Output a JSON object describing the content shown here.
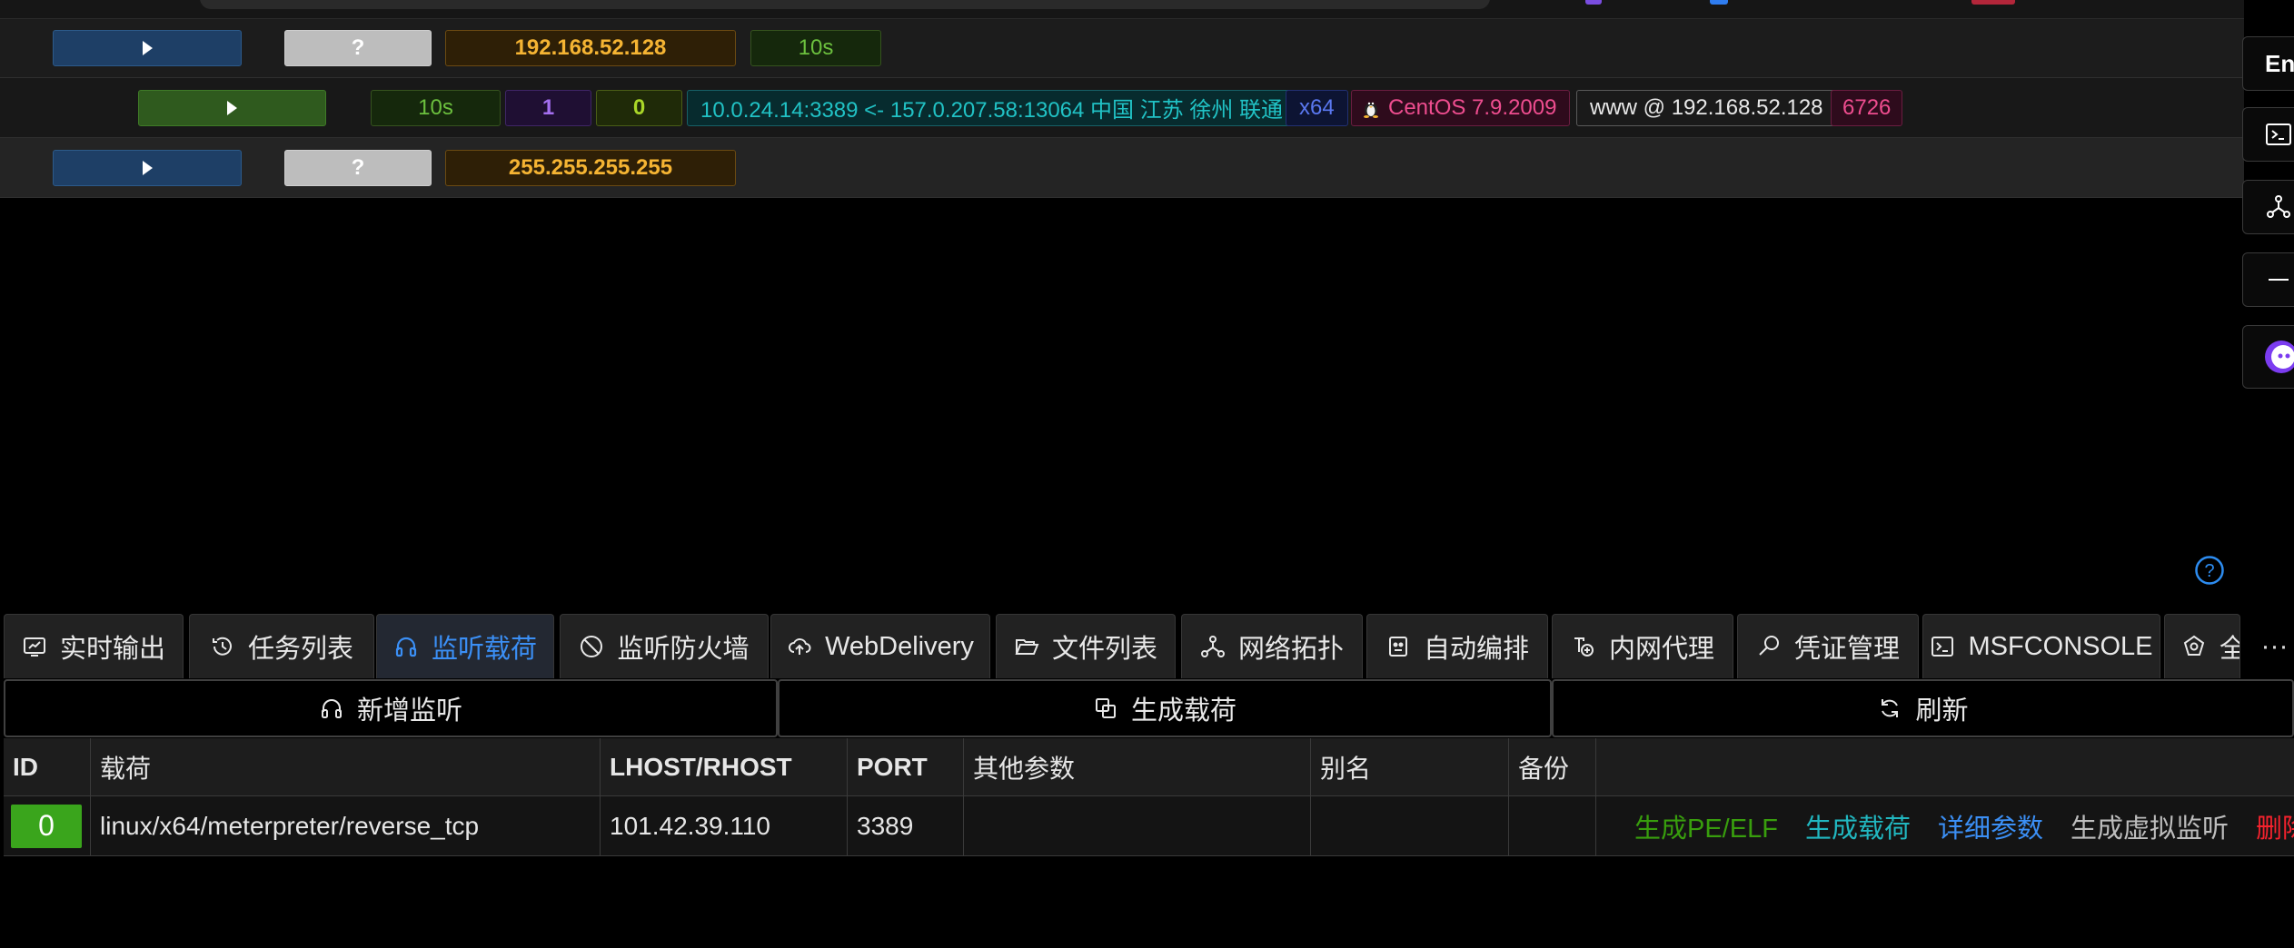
{
  "sessions": {
    "row1": {
      "status": "?",
      "ip": "192.168.52.128",
      "interval": "10s"
    },
    "row2": {
      "interval": "10s",
      "count_a": "1",
      "count_b": "0",
      "connection": "10.0.24.14:3389 <- 157.0.207.58:13064 中国 江苏 徐州 联通",
      "arch": "x64",
      "os": "CentOS 7.9.2009",
      "user_host": "www @ 192.168.52.128",
      "pid": "6726"
    },
    "row3": {
      "status": "?",
      "ip": "255.255.255.255"
    }
  },
  "side_buttons": {
    "lang_label": "En"
  },
  "tabs": [
    {
      "label": "实时输出",
      "icon": "monitor-icon"
    },
    {
      "label": "任务列表",
      "icon": "history-icon"
    },
    {
      "label": "监听载荷",
      "icon": "headphones-icon",
      "active": true
    },
    {
      "label": "监听防火墙",
      "icon": "stop-icon"
    },
    {
      "label": "WebDelivery",
      "icon": "cloud-upload-icon"
    },
    {
      "label": "文件列表",
      "icon": "folder-open-icon"
    },
    {
      "label": "网络拓扑",
      "icon": "topology-icon"
    },
    {
      "label": "自动编排",
      "icon": "robot-icon"
    },
    {
      "label": "内网代理",
      "icon": "proxy-icon"
    },
    {
      "label": "凭证管理",
      "icon": "key-search-icon"
    },
    {
      "label": "MSFCONSOLE",
      "icon": "terminal-icon"
    },
    {
      "label": "全",
      "icon": "settings-icon"
    }
  ],
  "tab_overflow": "···",
  "actions": {
    "add_listener": "新增监听",
    "generate_payload": "生成载荷",
    "refresh": "刷新"
  },
  "table": {
    "headers": {
      "id": "ID",
      "payload": "载荷",
      "lhost": "LHOST/RHOST",
      "port": "PORT",
      "other": "其他参数",
      "alias": "别名",
      "note": "备份"
    },
    "rows": [
      {
        "id": "0",
        "payload": "linux/x64/meterpreter/reverse_tcp",
        "lhost": "101.42.39.110",
        "port": "3389",
        "other": "",
        "alias": "",
        "note": "",
        "ops": {
          "gen_pe_elf": "生成PE/ELF",
          "gen_payload": "生成载荷",
          "details": "详细参数",
          "gen_virtual": "生成虚拟监听",
          "delete": "删除"
        }
      }
    ]
  },
  "colors": {
    "accent_blue": "#3b8ff5",
    "op_green": "#3aa51c",
    "op_cyan": "#21b7c0",
    "op_red": "#f5222d",
    "ip_gold": "#f5b433"
  }
}
